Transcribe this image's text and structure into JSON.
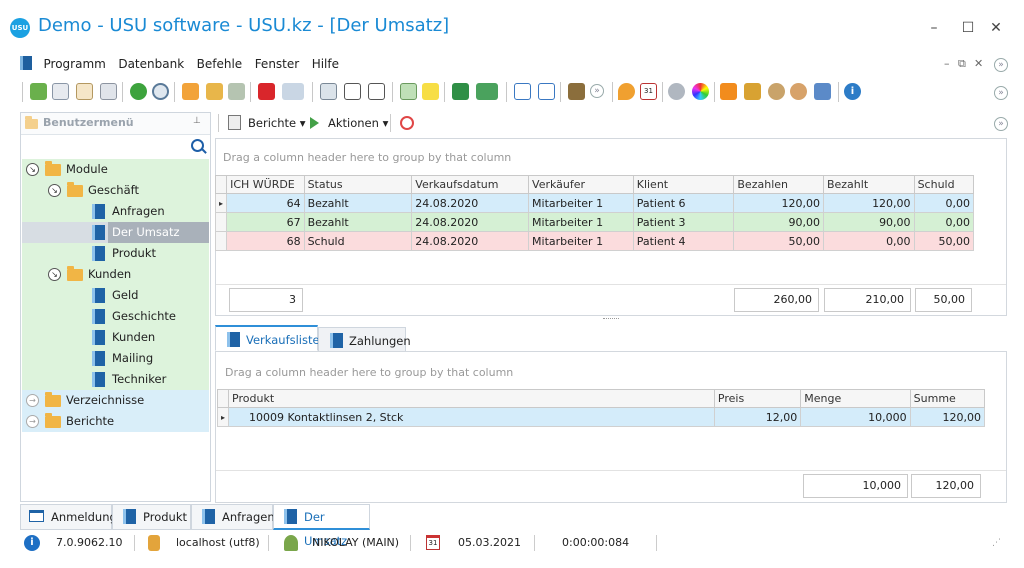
{
  "window": {
    "logo_text": "USU",
    "title": "Demo - USU software - USU.kz - [Der Umsatz]",
    "controls": [
      "–",
      "☐",
      "✕"
    ]
  },
  "menu": {
    "items": [
      "Programm",
      "Datenbank",
      "Befehle",
      "Fenster",
      "Hilfe"
    ],
    "mdi_controls": [
      "–",
      "⧉",
      "✕"
    ]
  },
  "left_panel": {
    "header": "Benutzermenü",
    "pin": "📌",
    "tree": [
      {
        "label": "Module",
        "level": 0,
        "type": "folder",
        "expanded": true,
        "style": "g"
      },
      {
        "label": "Geschäft",
        "level": 1,
        "type": "folder",
        "expanded": true,
        "style": "g"
      },
      {
        "label": "Anfragen",
        "level": 2,
        "type": "doc",
        "style": "g"
      },
      {
        "label": "Der Umsatz",
        "level": 2,
        "type": "doc",
        "style": "sel"
      },
      {
        "label": "Produkt",
        "level": 2,
        "type": "doc",
        "style": "g"
      },
      {
        "label": "Kunden",
        "level": 1,
        "type": "folder",
        "expanded": true,
        "style": "g"
      },
      {
        "label": "Geld",
        "level": 2,
        "type": "doc",
        "style": "g"
      },
      {
        "label": "Geschichte",
        "level": 2,
        "type": "doc",
        "style": "g"
      },
      {
        "label": "Kunden",
        "level": 2,
        "type": "doc",
        "style": "g"
      },
      {
        "label": "Mailing",
        "level": 2,
        "type": "doc",
        "style": "g"
      },
      {
        "label": "Techniker",
        "level": 2,
        "type": "doc",
        "style": "g"
      },
      {
        "label": "Verzeichnisse",
        "level": 0,
        "type": "folder",
        "expanded": false,
        "style": "b"
      },
      {
        "label": "Berichte",
        "level": 0,
        "type": "folder",
        "expanded": false,
        "style": "b"
      }
    ]
  },
  "right_toolbar": {
    "reports_label": "Berichte",
    "actions_label": "Aktionen"
  },
  "top_grid": {
    "group_hint": "Drag a column header here to group by that column",
    "columns": [
      "ICH WÜRDE",
      "Status",
      "Verkaufsdatum",
      "Verkäufer",
      "Klient",
      "Bezahlen",
      "Bezahlt",
      "Schuld"
    ],
    "rows": [
      {
        "style": "blue",
        "cells": [
          "64",
          "Bezahlt",
          "24.08.2020",
          "Mitarbeiter 1",
          "Patient 6",
          "120,00",
          "120,00",
          "0,00"
        ]
      },
      {
        "style": "green",
        "cells": [
          "67",
          "Bezahlt",
          "24.08.2020",
          "Mitarbeiter 1",
          "Patient 3",
          "90,00",
          "90,00",
          "0,00"
        ]
      },
      {
        "style": "pink",
        "cells": [
          "68",
          "Schuld",
          "24.08.2020",
          "Mitarbeiter 1",
          "Patient 4",
          "50,00",
          "0,00",
          "50,00"
        ]
      }
    ],
    "totals": {
      "count": "3",
      "bezahlen": "260,00",
      "bezahlt": "210,00",
      "schuld": "50,00"
    }
  },
  "detail_tabs": [
    "Verkaufsliste",
    "Zahlungen"
  ],
  "bottom_grid": {
    "group_hint": "Drag a column header here to group by that column",
    "columns": [
      "Produkt",
      "Preis",
      "Menge",
      "Summe"
    ],
    "rows": [
      {
        "cells": [
          "10009 Kontaktlinsen 2, Stck",
          "12,00",
          "10,000",
          "120,00"
        ]
      }
    ],
    "totals": {
      "menge": "10,000",
      "summe": "120,00"
    }
  },
  "window_tabs": [
    "Anmeldung",
    "Produkt",
    "Anfragen",
    "Der Umsatz"
  ],
  "status": {
    "version": "7.0.9062.10",
    "server": "localhost (utf8)",
    "user": "NIKOLAY (MAIN)",
    "calendar_day": "31",
    "date": "05.03.2021",
    "timer": "0:00:00:084"
  },
  "colors": {
    "accent": "#1a8ad4",
    "row_blue": "#d4ecfa",
    "row_green": "#d5f0d4",
    "row_pink": "#fbdcdd"
  }
}
